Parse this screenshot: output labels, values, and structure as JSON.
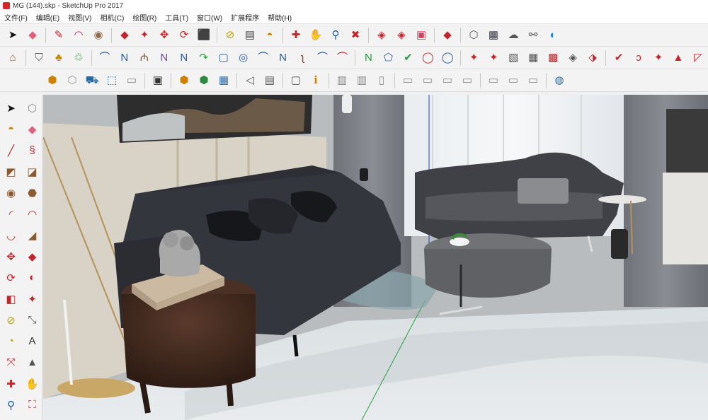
{
  "window": {
    "title": "MG (144).skp - SketchUp Pro 2017"
  },
  "menu": [
    "文件(F)",
    "编辑(E)",
    "视图(V)",
    "相机(C)",
    "绘图(R)",
    "工具(T)",
    "窗口(W)",
    "扩展程序",
    "帮助(H)"
  ],
  "toolbar_row1": [
    {
      "icon": "select-arrow-icon",
      "glyph": "➤",
      "color": "#111"
    },
    {
      "icon": "eraser-icon",
      "glyph": "◆",
      "color": "#e0607a"
    },
    {
      "sep": true
    },
    {
      "icon": "pencil-line-icon",
      "glyph": "✎",
      "color": "#c0262c"
    },
    {
      "icon": "arc-icon",
      "glyph": "◠",
      "color": "#c0262c"
    },
    {
      "icon": "circle-icon",
      "glyph": "◉",
      "color": "#8c6a4a"
    },
    {
      "sep": true
    },
    {
      "icon": "push-pull-icon",
      "glyph": "◆",
      "color": "#c0262c"
    },
    {
      "icon": "follow-me-icon",
      "glyph": "✦",
      "color": "#c0262c"
    },
    {
      "icon": "move-icon",
      "glyph": "✥",
      "color": "#c0262c"
    },
    {
      "icon": "rotate-icon",
      "glyph": "⟳",
      "color": "#c0262c"
    },
    {
      "icon": "scale-icon",
      "glyph": "⬛",
      "color": "#c0262c"
    },
    {
      "sep": true
    },
    {
      "icon": "tape-measure-icon",
      "glyph": "⊘",
      "color": "#b8a000"
    },
    {
      "icon": "text-icon",
      "glyph": "▤",
      "color": "#444"
    },
    {
      "icon": "paint-bucket-icon",
      "glyph": "◓",
      "color": "#c08a00"
    },
    {
      "sep": true
    },
    {
      "icon": "orbit-icon",
      "glyph": "✚",
      "color": "#c0262c"
    },
    {
      "icon": "pan-icon",
      "glyph": "✋",
      "color": "#c08a40"
    },
    {
      "icon": "zoom-icon",
      "glyph": "⚲",
      "color": "#1a5aa0"
    },
    {
      "icon": "zoom-extents-icon",
      "glyph": "✖",
      "color": "#c0262c"
    },
    {
      "sep": true
    },
    {
      "icon": "warehouse-icon",
      "glyph": "◈",
      "color": "#c0262c"
    },
    {
      "icon": "share-model-icon",
      "glyph": "◈",
      "color": "#c0262c"
    },
    {
      "icon": "components-icon",
      "glyph": "▣",
      "color": "#d04060"
    },
    {
      "sep": true
    },
    {
      "icon": "extension-warehouse-icon",
      "glyph": "◆",
      "color": "#c0262c"
    },
    {
      "sep": true
    },
    {
      "icon": "style-builder-icon",
      "glyph": "⬡",
      "color": "#555"
    },
    {
      "icon": "send-layout-icon",
      "glyph": "▦",
      "color": "#334"
    },
    {
      "icon": "upload-cloud-icon",
      "glyph": "☁",
      "color": "#555"
    },
    {
      "icon": "link-icon",
      "glyph": "⚯",
      "color": "#555"
    },
    {
      "icon": "trimble-connect-icon",
      "glyph": "◐",
      "color": "#1a8ad0"
    }
  ],
  "toolbar_row2": [
    {
      "icon": "warehouse-building-icon",
      "glyph": "⌂",
      "color": "#8a5a30"
    },
    {
      "sep": true
    },
    {
      "icon": "section-shield-icon",
      "glyph": "⛉",
      "color": "#555"
    },
    {
      "icon": "paint-tools-icon",
      "glyph": "♣",
      "color": "#c08a00"
    },
    {
      "icon": "recycle-icon",
      "glyph": "♲",
      "color": "#2a9a40"
    },
    {
      "sep": true
    },
    {
      "icon": "curve-tool-1-icon",
      "glyph": "⌒",
      "color": "#2a5aa0"
    },
    {
      "icon": "curve-tool-2-icon",
      "glyph": "N",
      "color": "#2a5aa0"
    },
    {
      "icon": "curve-tool-3-icon",
      "glyph": "₼",
      "color": "#8a5a30"
    },
    {
      "icon": "curve-tool-4-icon",
      "glyph": "N",
      "color": "#6a4aa0"
    },
    {
      "icon": "curve-tool-5-icon",
      "glyph": "N",
      "color": "#2a5aa0"
    },
    {
      "icon": "curve-tool-6-icon",
      "glyph": "↷",
      "color": "#2a9a40"
    },
    {
      "icon": "rect-tool-icon",
      "glyph": "▢",
      "color": "#2a5aa0"
    },
    {
      "icon": "circle-tool-icon",
      "glyph": "◎",
      "color": "#2a5aa0"
    },
    {
      "icon": "arc-tool-icon",
      "glyph": "⌒",
      "color": "#2a5aa0"
    },
    {
      "icon": "curve-tool-7-icon",
      "glyph": "N",
      "color": "#2a5aa0"
    },
    {
      "icon": "curve-tool-8-icon",
      "glyph": "ʅ",
      "color": "#c0262c"
    },
    {
      "icon": "curve-tool-9-icon",
      "glyph": "⌒",
      "color": "#2a5aa0"
    },
    {
      "icon": "curve-tool-10-icon",
      "glyph": "⌒",
      "color": "#c0262c"
    },
    {
      "sep": true
    },
    {
      "icon": "curve-tool-11-icon",
      "glyph": "N",
      "color": "#2a9a40"
    },
    {
      "icon": "polygon-tool-icon",
      "glyph": "⬠",
      "color": "#2a5aa0"
    },
    {
      "icon": "wrench-icon",
      "glyph": "✔",
      "color": "#2a9a40"
    },
    {
      "icon": "ellipse-tool-icon",
      "glyph": "◯",
      "color": "#c0262c"
    },
    {
      "icon": "ellipse-tool-2-icon",
      "glyph": "◯",
      "color": "#2a5aa0"
    },
    {
      "sep": true
    },
    {
      "icon": "plugin-1-icon",
      "glyph": "✦",
      "color": "#c0262c"
    },
    {
      "icon": "plugin-2-icon",
      "glyph": "✦",
      "color": "#c0262c"
    },
    {
      "icon": "plugin-3-icon",
      "glyph": "▧",
      "color": "#555"
    },
    {
      "icon": "plugin-4-icon",
      "glyph": "▦",
      "color": "#555"
    },
    {
      "icon": "plugin-5-icon",
      "glyph": "▩",
      "color": "#c0262c"
    },
    {
      "icon": "plugin-6-icon",
      "glyph": "◈",
      "color": "#555"
    },
    {
      "icon": "plugin-7-icon",
      "glyph": "⬗",
      "color": "#c0262c"
    },
    {
      "sep": true
    },
    {
      "icon": "plugin-8-icon",
      "glyph": "✔",
      "color": "#c0262c"
    },
    {
      "icon": "plugin-9-icon",
      "glyph": "ↄ",
      "color": "#c0262c"
    },
    {
      "icon": "plugin-10-icon",
      "glyph": "✦",
      "color": "#c0262c"
    },
    {
      "icon": "plugin-11-icon",
      "glyph": "▲",
      "color": "#c0262c"
    },
    {
      "icon": "plugin-12-icon",
      "glyph": "◸",
      "color": "#c0262c"
    }
  ],
  "toolbar_row3": [
    {
      "icon": "view-iso-icon",
      "glyph": "⬢",
      "color": "#d08000"
    },
    {
      "icon": "view-xray-icon",
      "glyph": "⬡",
      "color": "#999"
    },
    {
      "icon": "view-top-icon",
      "glyph": "⛟",
      "color": "#2a6aa0"
    },
    {
      "icon": "view-front-icon",
      "glyph": "⬚",
      "color": "#2a6aa0"
    },
    {
      "icon": "view-right-icon",
      "glyph": "▭",
      "color": "#888"
    },
    {
      "sep": true
    },
    {
      "icon": "camera-icon",
      "glyph": "▣",
      "color": "#333"
    },
    {
      "sep": true
    },
    {
      "icon": "style-wire-icon",
      "glyph": "⬢",
      "color": "#d08000"
    },
    {
      "icon": "style-shaded-icon",
      "glyph": "⬢",
      "color": "#2a8a40"
    },
    {
      "icon": "style-texture-icon",
      "glyph": "▦",
      "color": "#2a6aa0"
    },
    {
      "sep": true
    },
    {
      "icon": "section-plane-icon",
      "glyph": "◁",
      "color": "#555"
    },
    {
      "icon": "section-display-icon",
      "glyph": "▤",
      "color": "#555"
    },
    {
      "sep": true
    },
    {
      "icon": "tape-icon",
      "glyph": "▢",
      "color": "#555"
    },
    {
      "icon": "info-icon",
      "glyph": "ℹ",
      "color": "#d08000"
    },
    {
      "sep": true
    },
    {
      "icon": "scene-1-icon",
      "glyph": "▥",
      "color": "#888"
    },
    {
      "icon": "scene-2-icon",
      "glyph": "▥",
      "color": "#888"
    },
    {
      "icon": "scene-3-icon",
      "glyph": "▯",
      "color": "#888"
    },
    {
      "sep": true
    },
    {
      "icon": "scene-4-icon",
      "glyph": "▭",
      "color": "#888"
    },
    {
      "icon": "scene-5-icon",
      "glyph": "▭",
      "color": "#888"
    },
    {
      "icon": "scene-6-icon",
      "glyph": "▭",
      "color": "#888"
    },
    {
      "icon": "scene-7-icon",
      "glyph": "▭",
      "color": "#888"
    },
    {
      "sep": true
    },
    {
      "icon": "scene-8-icon",
      "glyph": "▭",
      "color": "#888"
    },
    {
      "icon": "scene-9-icon",
      "glyph": "▭",
      "color": "#888"
    },
    {
      "icon": "scene-10-icon",
      "glyph": "▭",
      "color": "#888"
    },
    {
      "sep": true
    },
    {
      "icon": "globe-icon",
      "glyph": "◍",
      "color": "#2a6aa0"
    }
  ],
  "left_toolbar": [
    {
      "icon": "select-arrow-icon",
      "glyph": "➤",
      "color": "#111"
    },
    {
      "icon": "make-component-icon",
      "glyph": "⬡",
      "color": "#888"
    },
    {
      "icon": "paint-bucket-icon",
      "glyph": "◓",
      "color": "#c08a00"
    },
    {
      "icon": "eraser-icon",
      "glyph": "◆",
      "color": "#e0607a"
    },
    {
      "icon": "line-icon",
      "glyph": "╱",
      "color": "#c0262c"
    },
    {
      "icon": "freehand-icon",
      "glyph": "§",
      "color": "#c0262c"
    },
    {
      "icon": "rectangle-icon",
      "glyph": "◩",
      "color": "#8a5a30"
    },
    {
      "icon": "rotated-rect-icon",
      "glyph": "◪",
      "color": "#8a5a30"
    },
    {
      "icon": "circle-icon",
      "glyph": "◉",
      "color": "#8a5a30"
    },
    {
      "icon": "polygon-icon",
      "glyph": "⬣",
      "color": "#8a5a30"
    },
    {
      "icon": "arc-icon",
      "glyph": "◜",
      "color": "#c0262c"
    },
    {
      "icon": "2pt-arc-icon",
      "glyph": "◠",
      "color": "#c0262c"
    },
    {
      "icon": "3pt-arc-icon",
      "glyph": "◡",
      "color": "#c0262c"
    },
    {
      "icon": "pie-icon",
      "glyph": "◢",
      "color": "#8a5a30"
    },
    {
      "icon": "move-icon",
      "glyph": "✥",
      "color": "#c0262c"
    },
    {
      "icon": "push-pull-icon",
      "glyph": "◆",
      "color": "#c0262c"
    },
    {
      "icon": "rotate-icon",
      "glyph": "⟳",
      "color": "#c0262c"
    },
    {
      "icon": "follow-me-icon",
      "glyph": "◐",
      "color": "#c0262c"
    },
    {
      "icon": "scale-icon",
      "glyph": "◧",
      "color": "#c0262c"
    },
    {
      "icon": "offset-icon",
      "glyph": "✦",
      "color": "#c0262c"
    },
    {
      "icon": "tape-measure-icon",
      "glyph": "⊘",
      "color": "#b8a000"
    },
    {
      "icon": "dimension-icon",
      "glyph": "⤡",
      "color": "#555"
    },
    {
      "icon": "protractor-icon",
      "glyph": "◔",
      "color": "#b8a000"
    },
    {
      "icon": "text-icon",
      "glyph": "A",
      "color": "#333"
    },
    {
      "icon": "axes-icon",
      "glyph": "⤧",
      "color": "#c0262c"
    },
    {
      "icon": "3d-text-icon",
      "glyph": "▲",
      "color": "#555"
    },
    {
      "icon": "orbit-icon",
      "glyph": "✚",
      "color": "#c0262c"
    },
    {
      "icon": "pan-icon",
      "glyph": "✋",
      "color": "#c08a40"
    },
    {
      "icon": "zoom-icon",
      "glyph": "⚲",
      "color": "#1a5aa0"
    },
    {
      "icon": "zoom-window-icon",
      "glyph": "⛶",
      "color": "#c0262c"
    }
  ]
}
